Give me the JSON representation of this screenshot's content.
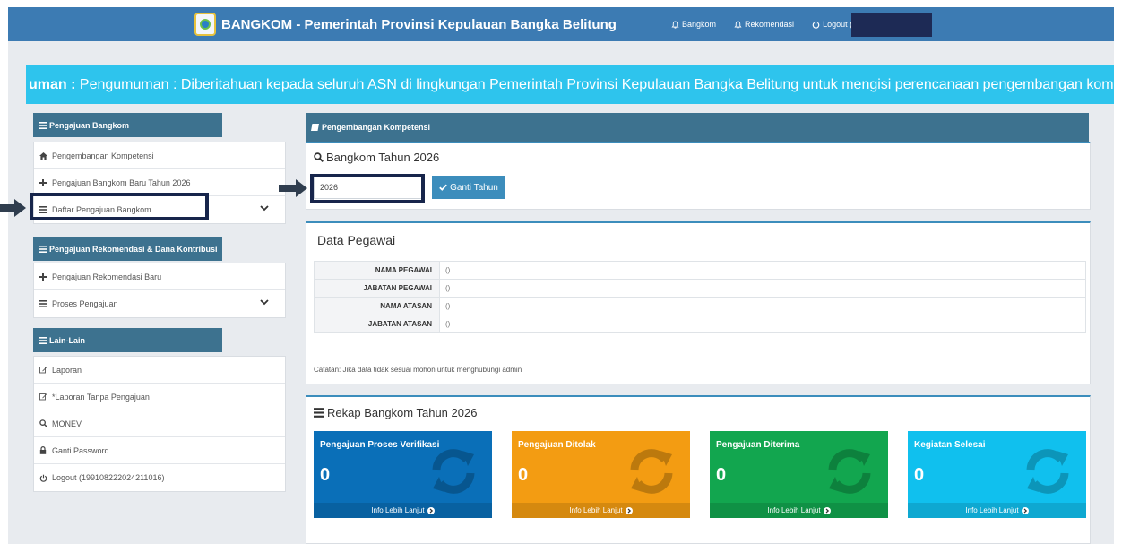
{
  "topbar": {
    "title": "BANGKOM - Pemerintah Provinsi Kepulauan Bangka Belitung",
    "nav": [
      {
        "label": "Bangkom",
        "icon": "bell-icon"
      },
      {
        "label": "Rekomendasi",
        "icon": "bell-icon"
      },
      {
        "label": "Logout (",
        "icon": "power-icon"
      }
    ]
  },
  "announcement": {
    "prefix": "uman : ",
    "text": "Pengumuman : Diberitahuan kepada seluruh ASN di lingkungan Pemerintah Provinsi Kepulauan Bangka Belitung untuk mengisi perencanaan pengembangan kompetensi dalam rangka menin"
  },
  "sidebar": {
    "sections": [
      {
        "title": "Pengajuan Bangkom",
        "items": [
          {
            "label": "Pengembangan Kompetensi",
            "icon": "home-icon"
          },
          {
            "label": "Pengajuan Bangkom Baru Tahun 2026",
            "icon": "plus-icon"
          },
          {
            "label": "Daftar Pengajuan Bangkom",
            "icon": "list-icon"
          }
        ]
      },
      {
        "title": "Pengajuan Rekomendasi & Dana Kontribusi",
        "items": [
          {
            "label": "Pengajuan Rekomendasi Baru",
            "icon": "plus-icon"
          },
          {
            "label": "Proses Pengajuan",
            "icon": "list-icon"
          }
        ]
      },
      {
        "title": "Lain-Lain",
        "items": [
          {
            "label": "Laporan",
            "icon": "edit-icon"
          },
          {
            "label": "*Laporan Tanpa Pengajuan",
            "icon": "edit-icon"
          },
          {
            "label": "MONEV",
            "icon": "search-icon"
          },
          {
            "label": "Ganti Password",
            "icon": "lock-icon"
          },
          {
            "label": "Logout (199108222024211016)",
            "icon": "power-icon"
          }
        ]
      }
    ]
  },
  "main": {
    "header": "Pengembangan Kompetensi",
    "year_panel": {
      "title": "Bangkom Tahun 2026",
      "input_value": "2026",
      "button_label": "Ganti Tahun"
    },
    "employee_panel": {
      "title": "Data Pegawai",
      "rows": [
        {
          "key": "NAMA PEGAWAI",
          "value": "()"
        },
        {
          "key": "JABATAN PEGAWAI",
          "value": "()"
        },
        {
          "key": "NAMA ATASAN",
          "value": "()"
        },
        {
          "key": "JABATAN ATASAN",
          "value": "()"
        }
      ],
      "note": "Catatan: Jika data tidak sesuai mohon untuk menghubungi admin"
    },
    "recap_panel": {
      "title": "Rekap Bangkom Tahun 2026",
      "cards": [
        {
          "label": "Pengajuan Proses Verifikasi",
          "count": "0",
          "footer": "Info Lebih Lanjut",
          "color": "#0a6fb8"
        },
        {
          "label": "Pengajuan Ditolak",
          "count": "0",
          "footer": "Info Lebih Lanjut",
          "color": "#f39c12"
        },
        {
          "label": "Pengajuan Diterima",
          "count": "0",
          "footer": "Info Lebih Lanjut",
          "color": "#12a64f"
        },
        {
          "label": "Kegiatan Selesai",
          "count": "0",
          "footer": "Info Lebih Lanjut",
          "color": "#10c0ee"
        }
      ]
    }
  },
  "colors": {
    "topbar": "#3c7bb3",
    "section_header": "#3d728f",
    "announcement": "#2ec4ed",
    "highlight": "#17254b"
  }
}
